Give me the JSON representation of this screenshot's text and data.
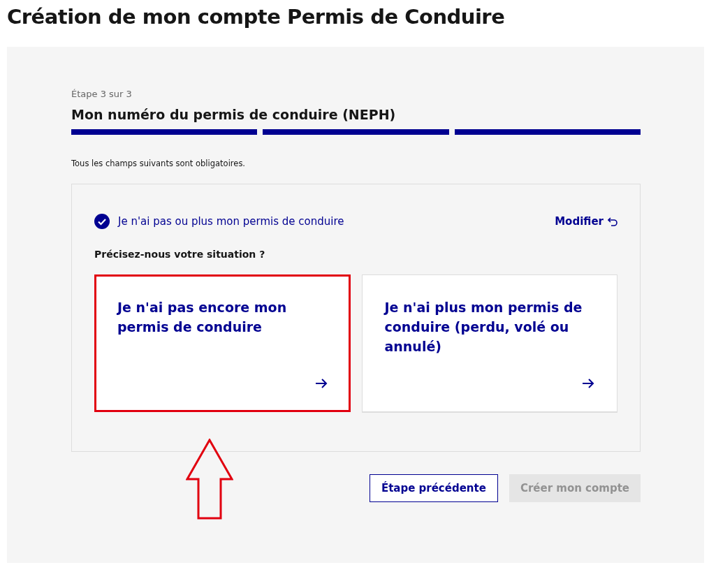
{
  "page_title": "Création de mon compte Permis de Conduire",
  "stepper": {
    "step_label": "Étape 3 sur 3",
    "title": "Mon numéro du permis de conduire (NEPH)",
    "steps": [
      {
        "done": true
      },
      {
        "done": true
      },
      {
        "done": true
      }
    ]
  },
  "required_notice": "Tous les champs suivants sont obligatoires.",
  "choice": {
    "answer": "Je n'ai pas ou plus mon permis de conduire",
    "edit_link": "Modifier",
    "question": "Précisez-nous votre situation ?",
    "cards": [
      {
        "label": "Je n'ai pas encore mon permis de conduire",
        "highlighted": true
      },
      {
        "label": "Je n'ai plus mon permis de conduire (perdu, volé ou annulé)",
        "highlighted": false
      }
    ]
  },
  "buttons": [
    {
      "label": "Étape précédente",
      "disabled": false
    },
    {
      "label": "Créer mon compte",
      "disabled": true
    }
  ]
}
